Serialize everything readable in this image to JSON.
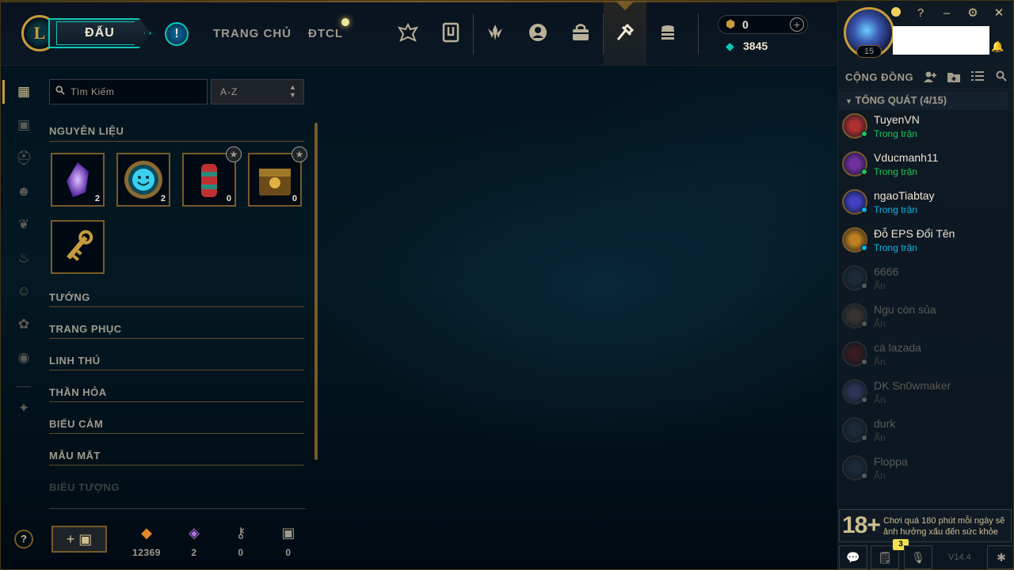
{
  "topbar": {
    "play_label": "ĐẤU",
    "alert_symbol": "!",
    "nav_links": [
      "TRANG CHỦ",
      "ĐTCL"
    ],
    "nav_icons": [
      "ranked-crest-icon",
      "collection-icon",
      "tft-icon",
      "profile-icon",
      "store-bag-icon",
      "loot-icon",
      "currency-stack-icon"
    ],
    "rp_value": "0",
    "be_value": "3845",
    "add_symbol": "+"
  },
  "window_controls": [
    "?",
    "–",
    "⚙",
    "✕"
  ],
  "profile": {
    "level": "15"
  },
  "social": {
    "title": "CỘNG ĐỒNG",
    "group_label": "TỔNG QUÁT (4/15)",
    "friends": [
      {
        "name": "TuyenVN",
        "status": "Trong trận",
        "online": true,
        "status_color": "#1ec45a"
      },
      {
        "name": "Vducmanh11",
        "status": "Trong trận",
        "online": true,
        "status_color": "#1ec45a"
      },
      {
        "name": "ngaoTiabtay",
        "status": "Trong trận",
        "online": true,
        "status_color": "#0ab4e6"
      },
      {
        "name": "Đỗ EPS Đổi Tên",
        "status": "Trong trận",
        "online": true,
        "status_color": "#0ab4e6"
      },
      {
        "name": "6666",
        "status": "Ẩn",
        "online": false
      },
      {
        "name": "Ngu còn sủa",
        "status": "Ẩn",
        "online": false
      },
      {
        "name": "cá lazada",
        "status": "Ẩn",
        "online": false
      },
      {
        "name": "DK Sn0wmaker",
        "status": "Ẩn",
        "online": false
      },
      {
        "name": "durk",
        "status": "Ẩn",
        "online": false
      },
      {
        "name": "Floppa",
        "status": "Ẩn",
        "online": false
      }
    ]
  },
  "age_notice": {
    "rating": "18+",
    "text": "Chơi quá 180 phút mỗi ngày sẽ ảnh hưởng xấu đến sức khỏe"
  },
  "bottom_bar": {
    "badge_count": "3",
    "version": "V14.4"
  },
  "loot": {
    "search_placeholder": "Tìm Kiếm",
    "sort_value": "A-Z",
    "sections": [
      "NGUYÊN LIỆU",
      "TƯỚNG",
      "TRANG PHỤC",
      "LINH THÚ",
      "THẦN HỎA",
      "BIỂU CẢM",
      "MẪU MẮT",
      "BIỂU TƯỢNG"
    ],
    "materials": [
      {
        "name": "mythic-essence",
        "count": "2",
        "starred": false
      },
      {
        "name": "emote-token",
        "count": "2",
        "starred": false
      },
      {
        "name": "event-orb",
        "count": "0",
        "starred": true
      },
      {
        "name": "hextech-chest",
        "count": "0",
        "starred": true
      },
      {
        "name": "key",
        "count": "",
        "starred": false
      }
    ],
    "currencies": [
      {
        "icon": "orange-essence-icon",
        "value": "12369",
        "color": "#e8862a"
      },
      {
        "icon": "mythic-essence-icon",
        "value": "2",
        "color": "#b070e0"
      },
      {
        "icon": "key-fragment-icon",
        "value": "0",
        "color": "#a09b8c"
      },
      {
        "icon": "chest-icon",
        "value": "0",
        "color": "#a09b8c"
      }
    ],
    "help_symbol": "?",
    "craft_label": "+ ▣"
  }
}
